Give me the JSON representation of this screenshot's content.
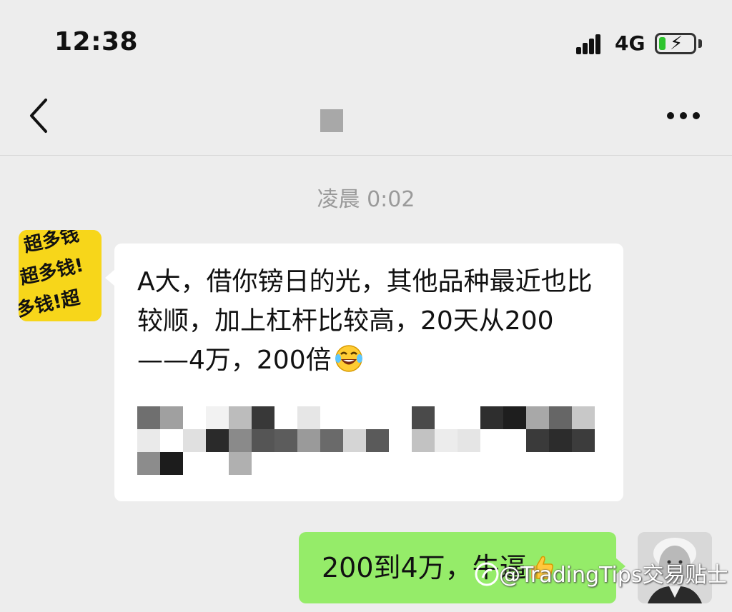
{
  "status_bar": {
    "time": "12:38",
    "network": "4G",
    "battery_level": 0.2,
    "battery_charging": true,
    "signal_icon": "signal-bars-icon"
  },
  "nav": {
    "back_icon": "chevron-left-icon",
    "more_icon": "more-dots-icon"
  },
  "chat": {
    "timestamp": "凌晨 0:02",
    "incoming": {
      "text": "A大，借你镑日的光，其他品种最近也比较顺，加上杠杆比较高，20天从200——4万，200倍",
      "emoji": "laughing-tears-icon",
      "avatar_icon": "avatar-yellow-icon"
    },
    "outgoing": {
      "text": "200到4万，牛逼",
      "emoji": "thumbs-up-icon",
      "avatar_icon": "avatar-portrait-icon"
    }
  },
  "watermark": {
    "text": "@TradingTips交易贴士"
  },
  "colors": {
    "background": "#ededed",
    "incoming_bubble": "#ffffff",
    "outgoing_bubble": "#95ec69",
    "timestamp_text": "#9a9a9a"
  }
}
